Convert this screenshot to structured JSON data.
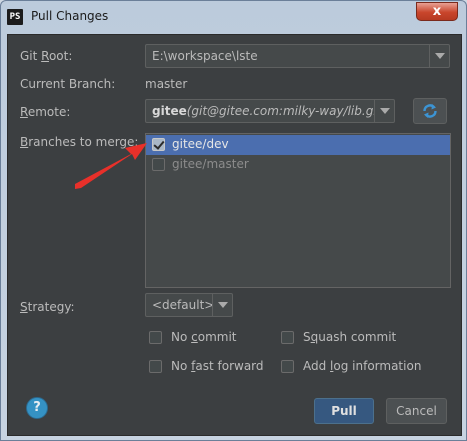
{
  "window": {
    "app_icon": "PS",
    "title": "Pull Changes",
    "close_label": "x"
  },
  "form": {
    "git_root_label_pre": "Git ",
    "git_root_label_mn": "R",
    "git_root_label_post": "oot:",
    "git_root_value": "E:\\workspace\\lste",
    "current_branch_label": "Current Branch:",
    "current_branch_value": "master",
    "remote_label_pre": "R",
    "remote_label_mn": "e",
    "remote_label_post": "mote:",
    "remote_name": "gitee",
    "remote_url": "(git@gitee.com:milky-way/lib.git)",
    "branches_label_mn": "B",
    "branches_label_post": "ranches to merge:",
    "branches": [
      {
        "name": "gitee/dev",
        "checked": true,
        "selected": true
      },
      {
        "name": "gitee/master",
        "checked": false,
        "selected": false
      }
    ],
    "strategy_label_mn": "S",
    "strategy_label_post": "trategy:",
    "strategy_value": "<default>"
  },
  "options": {
    "no_commit_pre": "No ",
    "no_commit_mn": "c",
    "no_commit_post": "ommit",
    "squash_pre": "S",
    "squash_mn": "q",
    "squash_post": "uash commit",
    "no_ff_pre": "No ",
    "no_ff_mn": "f",
    "no_ff_post": "ast forward",
    "add_log_pre": "Add ",
    "add_log_mn": "l",
    "add_log_post": "og information"
  },
  "footer": {
    "help_label": "?",
    "pull_label": "Pull",
    "cancel_label": "Cancel"
  },
  "colors": {
    "panel": "#3c3f41",
    "selection": "#4b6eaf",
    "primary_button": "#365880",
    "arrow_annotation": "#e8302a"
  },
  "icons": {
    "refresh": "refresh-icon",
    "help": "help-icon",
    "annotation": "red-arrow-annotation"
  }
}
